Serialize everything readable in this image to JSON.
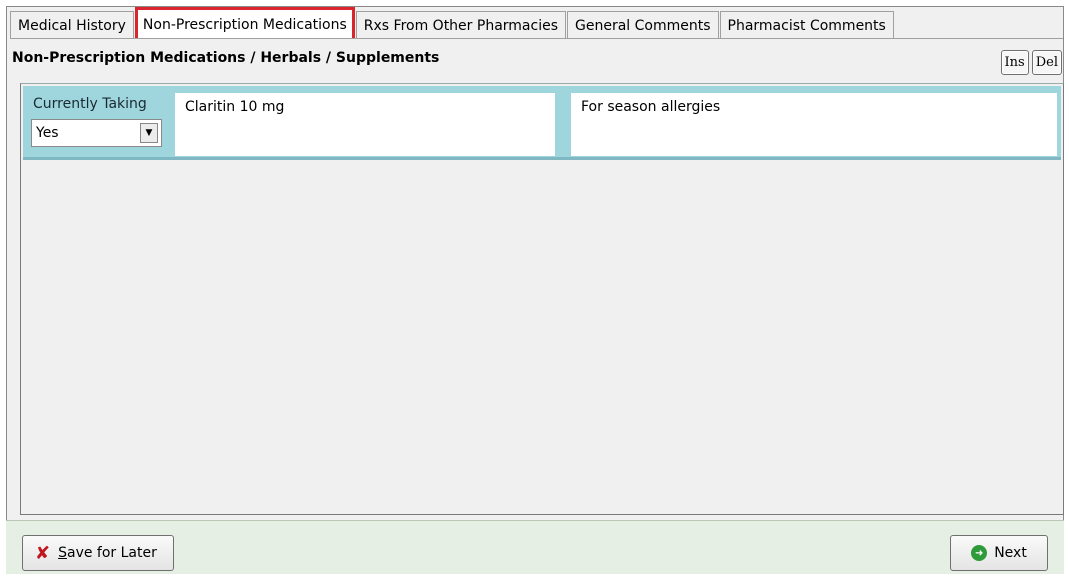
{
  "tabs": [
    {
      "label": "Medical History",
      "active": false
    },
    {
      "label": "Non-Prescription Medications",
      "active": true
    },
    {
      "label": "Rxs From Other Pharmacies",
      "active": false
    },
    {
      "label": "General Comments",
      "active": false
    },
    {
      "label": "Pharmacist Comments",
      "active": false
    }
  ],
  "section": {
    "title": "Non-Prescription Medications / Herbals / Supplements",
    "ins_label": "Ins",
    "del_label": "Del"
  },
  "row": {
    "currently_taking_label": "Currently Taking",
    "currently_taking_value": "Yes",
    "medication": "Claritin 10 mg",
    "note": "For season allergies"
  },
  "footer": {
    "save_label_first": "S",
    "save_label_rest": "ave for Later",
    "next_label": "Next"
  },
  "colors": {
    "active_tab_border": "#d9262c",
    "row_background": "#9fd6de",
    "footer_background": "#e6efe4"
  },
  "icons": {
    "save": "close-x-icon",
    "next": "arrow-right-circle-icon",
    "dropdown": "chevron-down-icon"
  }
}
